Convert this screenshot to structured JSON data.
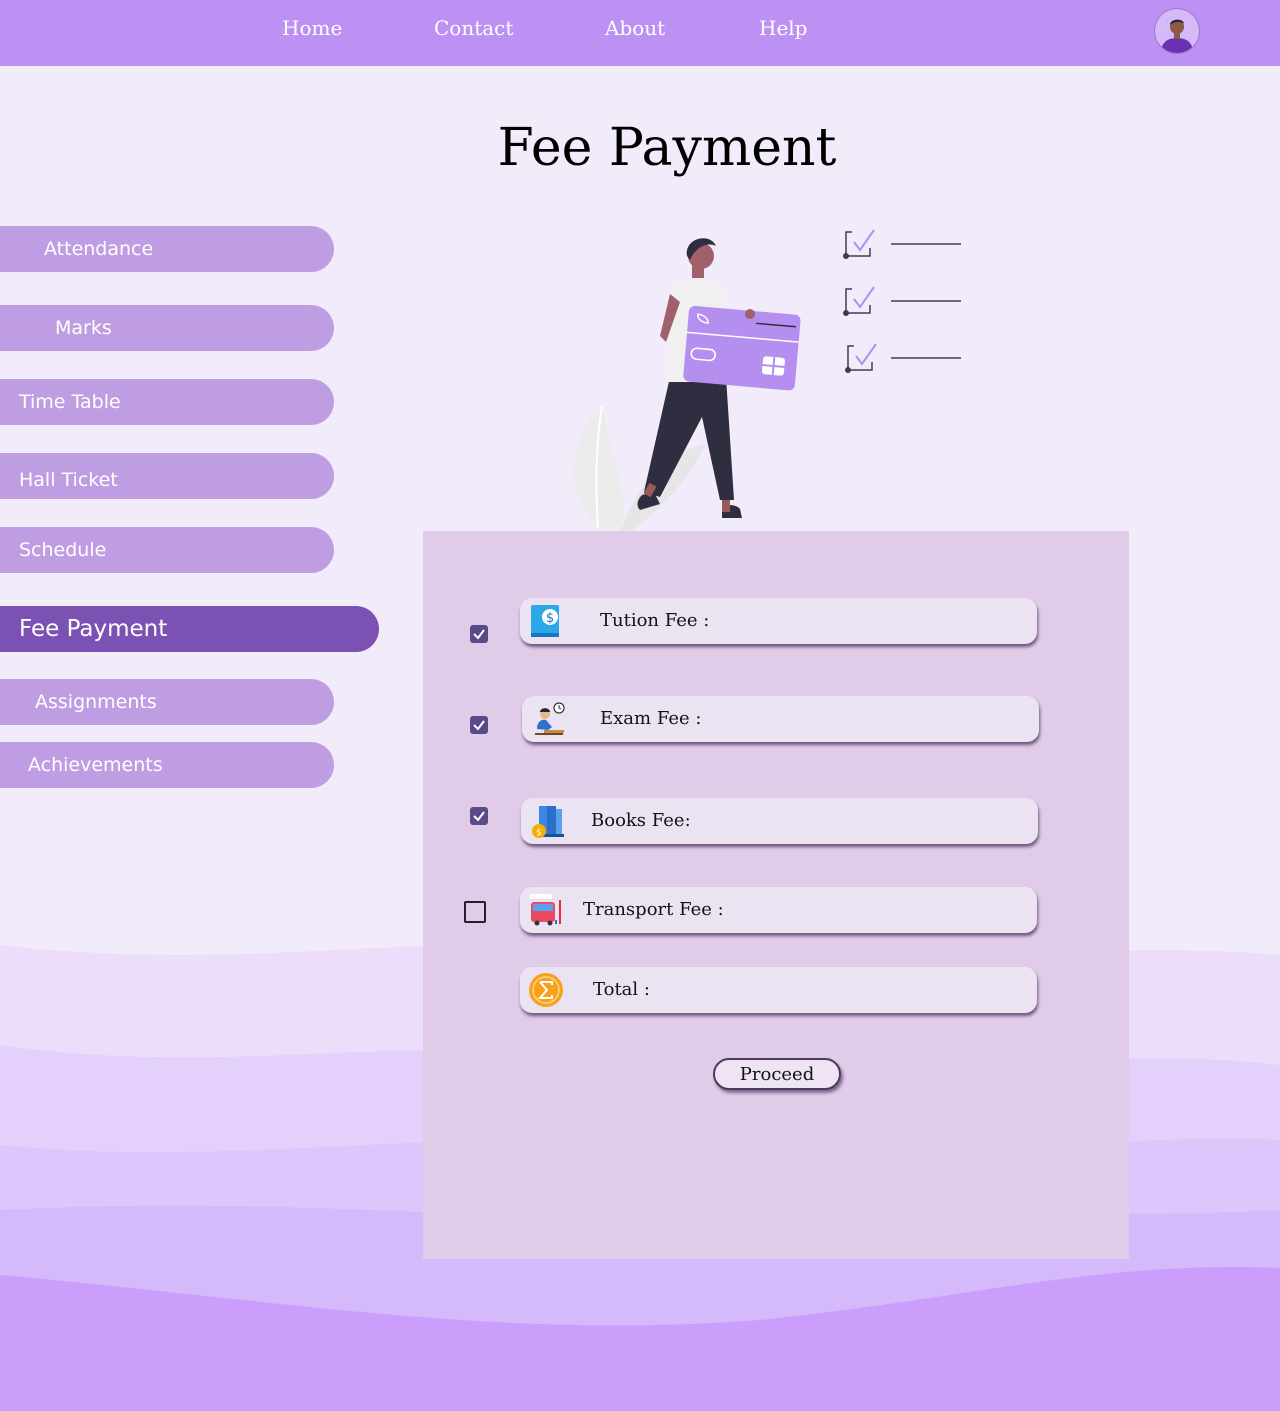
{
  "nav": {
    "links": [
      "Home",
      "Contact",
      "About",
      "Help"
    ]
  },
  "page": {
    "title": "Fee Payment"
  },
  "sidebar": {
    "items": [
      {
        "label": "Attendance",
        "active": false
      },
      {
        "label": "Marks",
        "active": false
      },
      {
        "label": "Time Table",
        "active": false
      },
      {
        "label": "Hall Ticket",
        "active": false
      },
      {
        "label": "Schedule",
        "active": false
      },
      {
        "label": "Fee Payment",
        "active": true
      },
      {
        "label": "Assignments",
        "active": false
      },
      {
        "label": "Achievements",
        "active": false
      }
    ]
  },
  "fees": {
    "rows": [
      {
        "label": "Tution Fee :",
        "icon": "tuition-book-dollar-icon",
        "checked": true
      },
      {
        "label": "Exam Fee :",
        "icon": "student-writing-exam-icon",
        "checked": true
      },
      {
        "label": "Books Fee:",
        "icon": "books-coins-icon",
        "checked": true
      },
      {
        "label": "Transport Fee :",
        "icon": "bus-transport-icon",
        "checked": false
      }
    ],
    "total": {
      "label": "Total :",
      "icon": "sigma-coin-icon"
    },
    "proceed_label": "Proceed"
  },
  "colors": {
    "topbar": "#bd90f3",
    "sidebar_item": "#bf9de3",
    "sidebar_active": "#7b52b3",
    "panel": "#e0cbe8",
    "page_background": "#f1ebfa"
  }
}
